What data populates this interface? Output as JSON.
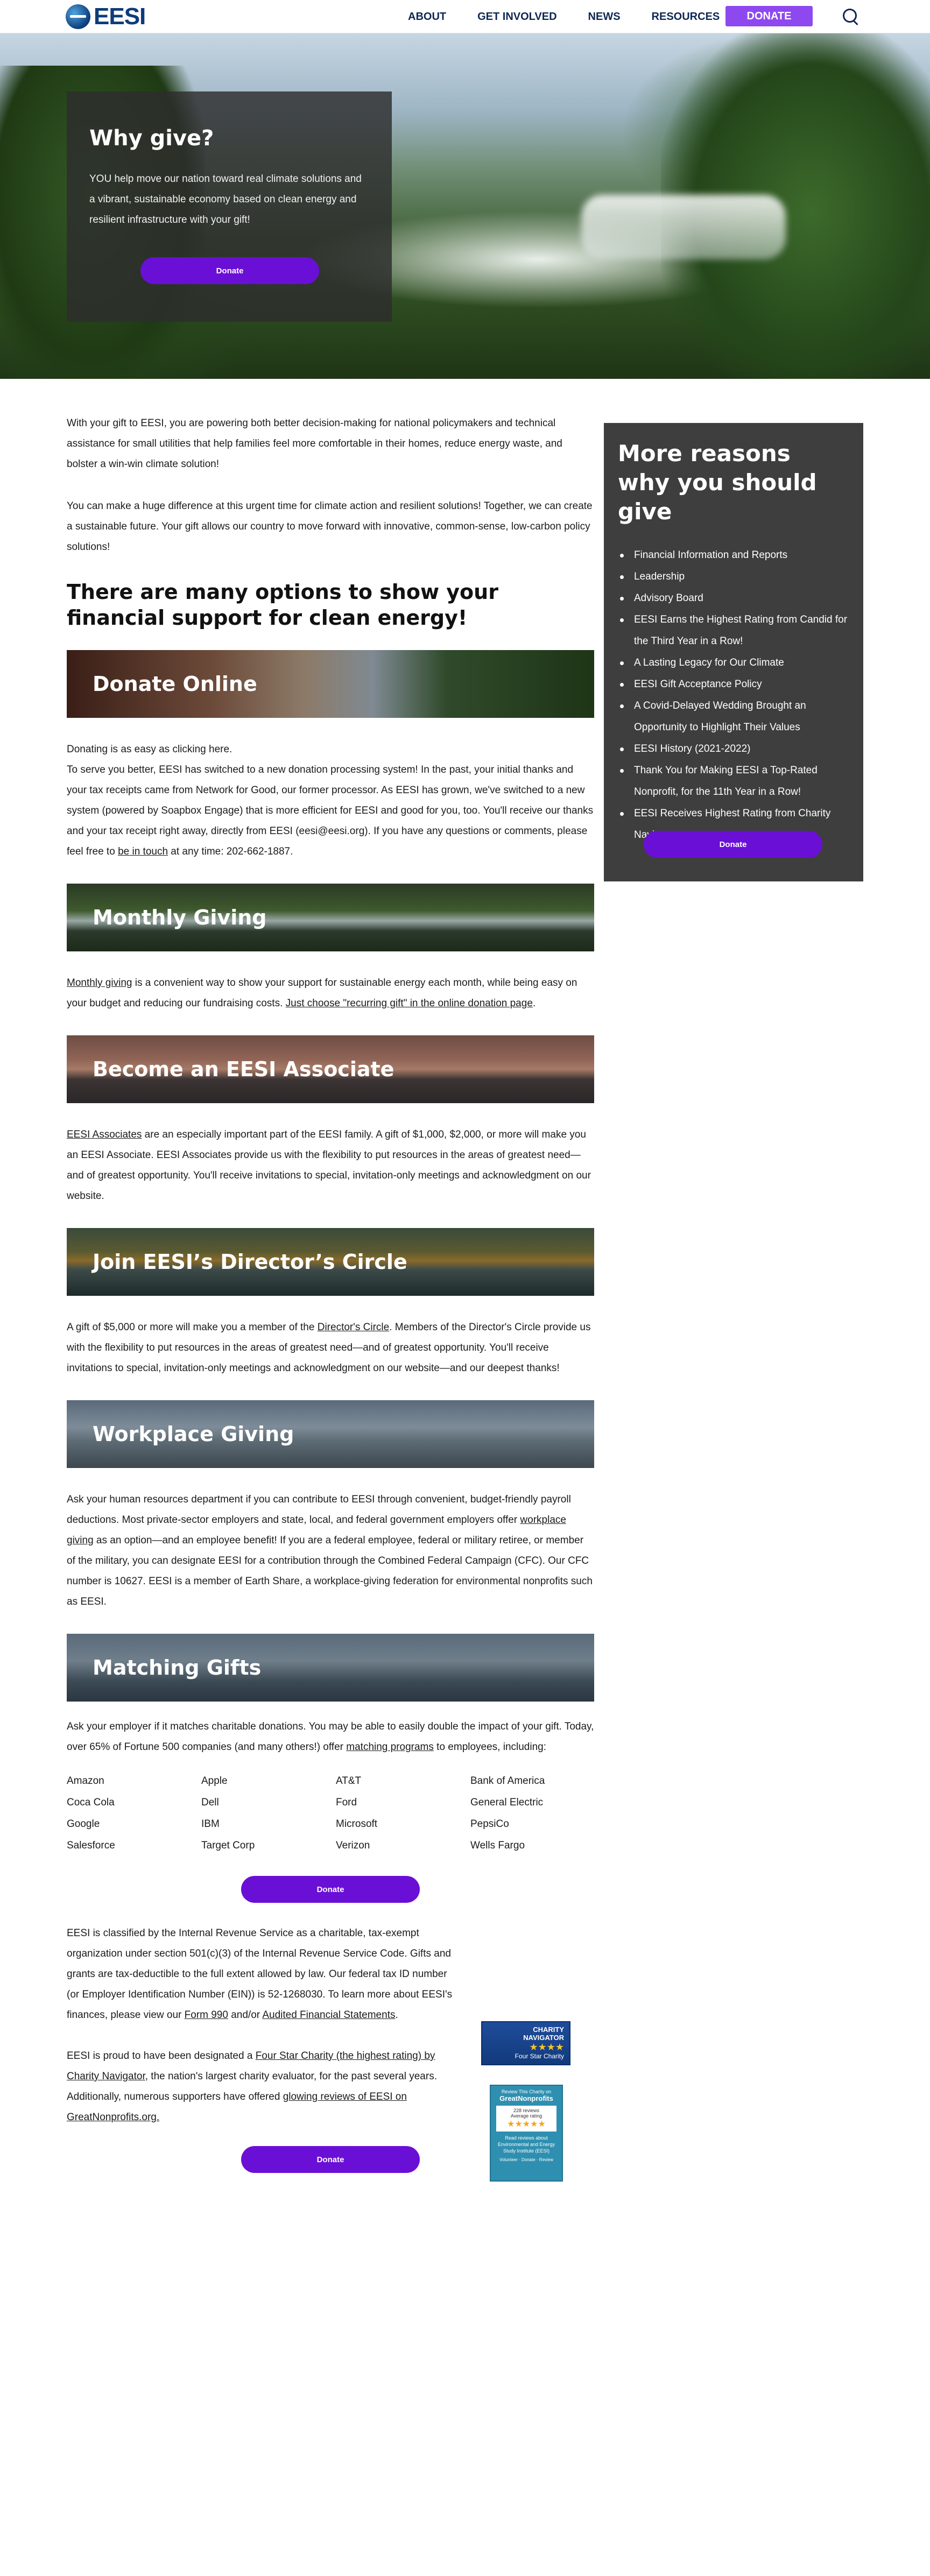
{
  "header": {
    "logo_text": "EESI",
    "nav": [
      "ABOUT",
      "GET INVOLVED",
      "NEWS",
      "RESOURCES"
    ],
    "donate_label": "DONATE"
  },
  "hero": {
    "title": "Why give?",
    "text": "YOU help move our nation toward real climate solutions and a vibrant, sustainable economy based on clean energy and resilient infrastructure with your gift!",
    "button": "Donate"
  },
  "intro": {
    "p1": "With your gift to EESI, you are powering both better decision-making for national policymakers and technical assistance for small utilities that help families feel more comfortable in their homes, reduce energy waste, and bolster a win-win climate solution!",
    "p2": "You can make a huge difference at this urgent time for climate action and resilient solutions! Together, we can create a sustainable future. Your gift allows our country to move forward with innovative, common-sense, low-carbon policy solutions!",
    "heading": "There are many options to show your financial support for clean energy!"
  },
  "donate_online": {
    "banner": "Donate Online",
    "text_a": "Donating is as easy as clicking here.",
    "text_b": "To serve you better, EESI has switched to a new donation processing system! In the past, your initial thanks and your tax receipts came from Network for Good, our former processor. As EESI has grown, we've switched to a new system (powered by Soapbox Engage) that is more efficient for EESI and good for you, too. You'll receive our thanks and your tax receipt right away, directly from EESI (eesi@eesi.org). If you have any questions or comments, please feel free to ",
    "link": "be in touch",
    "text_c": " at any time: 202-662-1887."
  },
  "monthly": {
    "banner": "Monthly Giving",
    "link1": "Monthly giving",
    "text": " is a convenient way to show your support for sustainable energy each month, while being easy on your budget and reducing our fundraising costs. ",
    "link2": "Just choose \"recurring gift\" in the online donation page",
    "end": "."
  },
  "associate": {
    "banner": "Become an EESI Associate",
    "link": "EESI Associates",
    "text": " are an especially important part of the EESI family. A gift of $1,000, $2,000, or more will make you an EESI Associate. EESI Associates provide us with the flexibility to put resources in the areas of greatest need—and of greatest opportunity. You'll receive invitations to special, invitation-only meetings and acknowledgment on our website."
  },
  "director": {
    "banner": "Join EESI’s Director’s Circle",
    "text_a": "A gift of $5,000 or more will make you a member of the ",
    "link": "Director's Circle",
    "text_b": ". Members of the Director's Circle provide us with the flexibility to put resources in the areas of greatest need—and of greatest opportunity. You'll receive invitations to special, invitation-only meetings and acknowledgment on our website—and our deepest thanks!"
  },
  "workplace": {
    "banner": "Workplace Giving",
    "text_a": "Ask your human resources department if you can contribute to EESI through convenient, budget-friendly payroll deductions. Most private-sector employers and state, local, and federal government employers offer ",
    "link": "workplace giving",
    "text_b": " as an option—and an employee benefit! If you are a federal employee, federal or military retiree, or member of the military, you can designate EESI for a contribution through the Combined Federal Campaign (CFC). Our CFC number is 10627. EESI is a member of Earth Share, a workplace-giving federation for environmental nonprofits such as EESI."
  },
  "matching": {
    "banner": "Matching Gifts",
    "text_a": "Ask your employer if it matches charitable donations. You may be able to easily double the impact of your gift. Today, over 65% of Fortune 500 companies (and many others!) offer ",
    "link": "matching programs",
    "text_b": " to employees, including:",
    "companies": [
      "Amazon",
      "Apple",
      "AT&T",
      "Bank of America",
      "Coca Cola",
      "Dell",
      "Ford",
      "General Electric",
      "Google",
      "IBM",
      "Microsoft",
      "PepsiCo",
      "Salesforce",
      "Target Corp",
      "Verizon",
      "Wells Fargo"
    ],
    "button": "Donate"
  },
  "irs": {
    "text_a": "EESI is classified by the Internal Revenue Service as a charitable, tax-exempt organization under section 501(c)(3) of the Internal Revenue Service Code. Gifts and grants are tax-deductible to the full extent allowed by law. Our federal tax ID number (or Employer Identification Number (EIN)) is 52-1268030. To learn more about EESI's finances, please view our ",
    "link1": "Form 990",
    "mid": " and/or ",
    "link2": "Audited Financial Statements",
    "end": "."
  },
  "rating": {
    "text_a": "EESI is proud to have been designated a ",
    "link1": "Four Star Charity (the highest rating) by Charity Navigator",
    "text_b": ", the nation's largest charity evaluator, for the past several years. Additionally, numerous supporters have offered ",
    "link2": "glowing reviews of EESI on GreatNonprofits.org.",
    "button": "Donate"
  },
  "badges": {
    "cn_line1": "CHARITY",
    "cn_line2": "NAVIGATOR",
    "cn_stars": "★★★★",
    "cn_line3": "Four Star Charity",
    "gn_line1": "Review This Charity on",
    "gn_line2": "GreatNonprofits",
    "gn_line3": "228 reviews",
    "gn_line4": "Average rating",
    "gn_stars": "★★★★★",
    "gn_line5": "Read reviews about Environmental and Energy Study Institute (EESI)",
    "gn_line6": "Volunteer · Donate · Review"
  },
  "sidebar": {
    "title": "More reasons why you should give",
    "items": [
      "Financial Information and Reports",
      "Leadership",
      "Advisory Board",
      "EESI Earns the Highest Rating from Candid for the Third Year in a Row!",
      "A Lasting Legacy for Our Climate",
      "EESI Gift Acceptance Policy",
      "A Covid-Delayed Wedding Brought an Opportunity to Highlight Their Values",
      "EESI History (2021-2022)",
      "Thank You for Making EESI a Top-Rated Nonprofit, for the 11th Year in a Row!",
      "EESI Receives Highest Rating from Charity Navigator"
    ],
    "button": "Donate"
  },
  "colors": {
    "accent": "#6a0fd6",
    "nav_donate": "#8e48f0",
    "navy": "#0d2752",
    "sidebar_bg": "#3e3e3e"
  }
}
